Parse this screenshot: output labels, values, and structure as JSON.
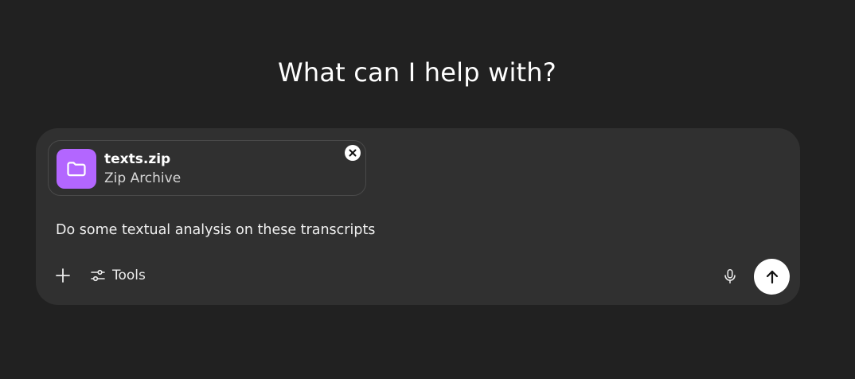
{
  "heading": "What can I help with?",
  "composer": {
    "attachment": {
      "file_name": "texts.zip",
      "file_type": "Zip Archive",
      "icon": "folder-icon",
      "icon_bg": "#b366ff"
    },
    "prompt_text": "Do some textual analysis on these transcripts",
    "toolbar": {
      "add_icon": "plus-icon",
      "tools_label": "Tools",
      "tools_icon": "sliders-icon",
      "mic_icon": "microphone-icon",
      "send_icon": "arrow-up-icon"
    }
  },
  "colors": {
    "background": "#212121",
    "composer": "#303030",
    "accent": "#b366ff"
  }
}
